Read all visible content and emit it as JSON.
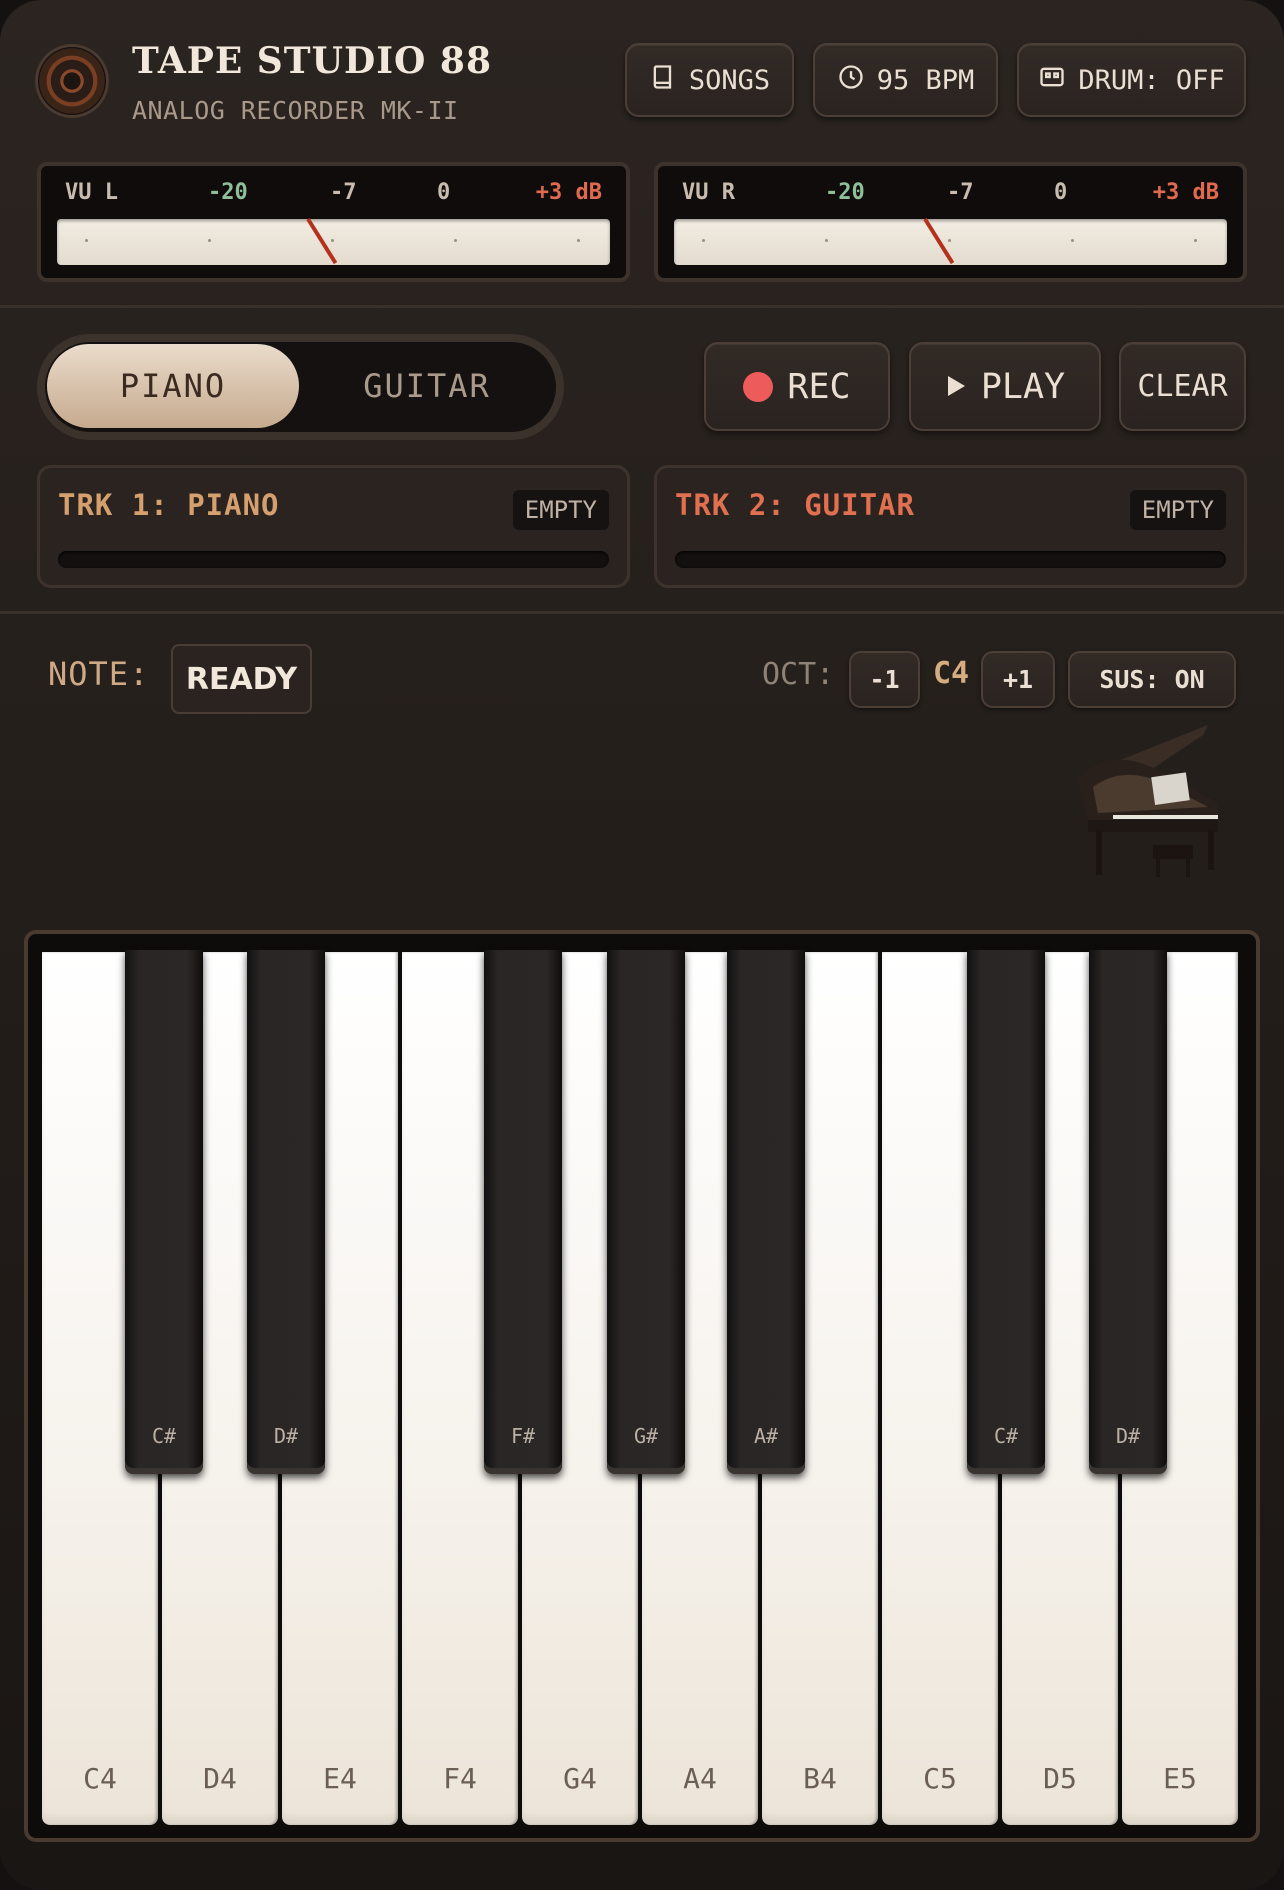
{
  "header": {
    "title": "TAPE STUDIO 88",
    "subtitle": "ANALOG RECORDER MK-II",
    "songs_label": "SONGS",
    "bpm_label": "95 BPM",
    "drum_label": "DRUM: OFF"
  },
  "vu": {
    "left": {
      "channel": "VU L",
      "ticks": [
        "-20",
        "-7",
        "0",
        "+3 dB"
      ],
      "level": 0.45
    },
    "right": {
      "channel": "VU R",
      "ticks": [
        "-20",
        "-7",
        "0",
        "+3 dB"
      ],
      "level": 0.45
    }
  },
  "instrument": {
    "options": [
      "PIANO",
      "GUITAR"
    ],
    "selected": "PIANO"
  },
  "transport": {
    "rec_label": "REC",
    "play_label": "PLAY",
    "clear_label": "CLEAR"
  },
  "tracks": [
    {
      "name": "TRK 1: PIANO",
      "status": "EMPTY",
      "color": "#d6a06e",
      "progress": 0
    },
    {
      "name": "TRK 2: GUITAR",
      "status": "EMPTY",
      "color": "#e0704f",
      "progress": 0
    }
  ],
  "note": {
    "label": "NOTE:",
    "value": "READY"
  },
  "octave": {
    "label": "OCT:",
    "down_label": "-1",
    "value": "C4",
    "up_label": "+1",
    "sustain_label": "SUS: ON"
  },
  "keyboard": {
    "white_keys": [
      "C4",
      "D4",
      "E4",
      "F4",
      "G4",
      "A4",
      "B4",
      "C5",
      "D5",
      "E5"
    ],
    "black_keys": [
      "C#",
      "D#",
      "F#",
      "G#",
      "A#",
      "C#",
      "D#"
    ]
  },
  "colors": {
    "accent": "#d6ad80",
    "rec": "#ee5b5b",
    "tick_green": "#8fbf9a",
    "tick_red": "#e06a4f"
  }
}
